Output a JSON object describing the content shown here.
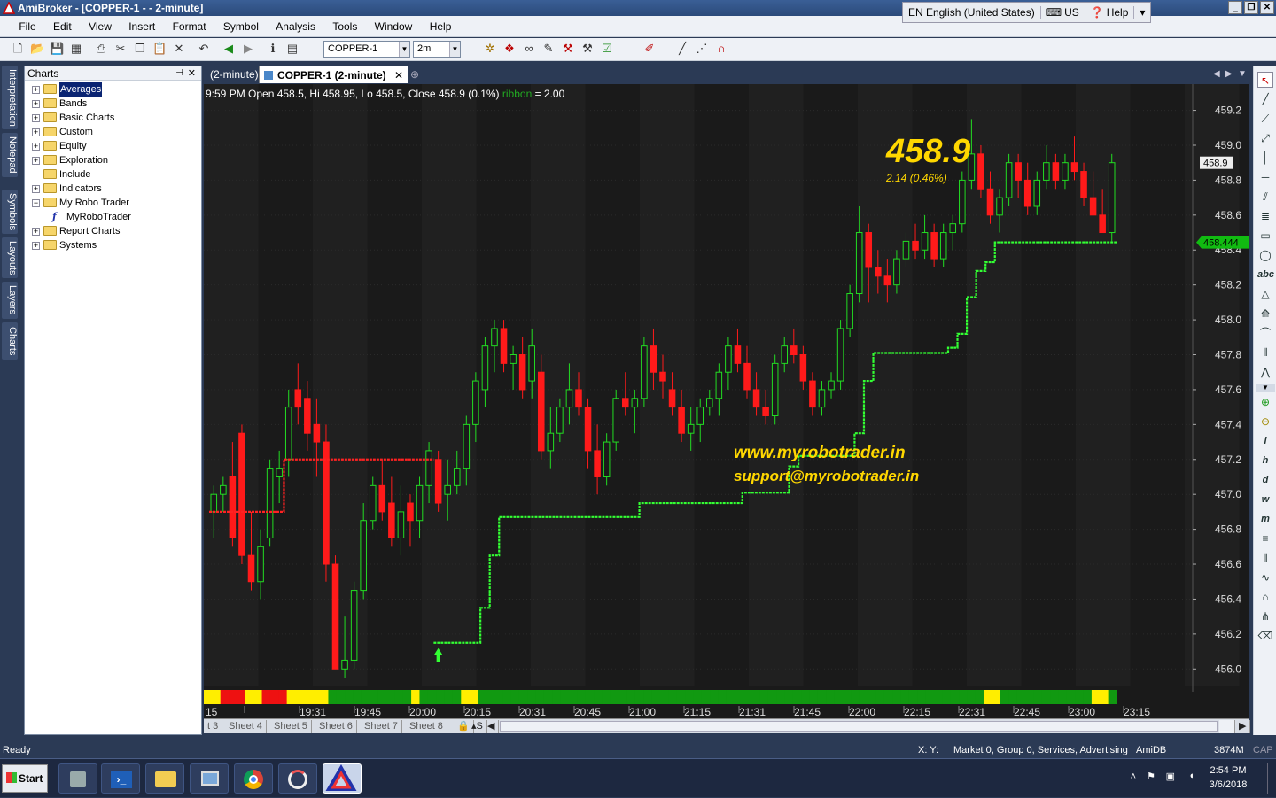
{
  "window": {
    "title": "AmiBroker - [COPPER-1 -  - 2-minute]",
    "buttons": [
      "_",
      "❐",
      "✕"
    ]
  },
  "menu": [
    "File",
    "Edit",
    "View",
    "Insert",
    "Format",
    "Symbol",
    "Analysis",
    "Tools",
    "Window",
    "Help"
  ],
  "langbar": {
    "language": "EN English (United States)",
    "keyboard": "US",
    "help": "Help"
  },
  "toolbar": {
    "symbol_combo": "COPPER-1",
    "interval_combo": "2m"
  },
  "left_tabs": [
    "Interpretation",
    "Notepad",
    "Symbols",
    "Layouts",
    "Layers",
    "Charts"
  ],
  "charts_panel": {
    "title": "Charts",
    "tree": [
      {
        "label": "Averages",
        "selected": true,
        "expandable": true,
        "type": "folder"
      },
      {
        "label": "Bands",
        "expandable": true,
        "type": "folder"
      },
      {
        "label": "Basic Charts",
        "expandable": true,
        "type": "folder"
      },
      {
        "label": "Custom",
        "expandable": true,
        "type": "folder"
      },
      {
        "label": "Equity",
        "expandable": true,
        "type": "folder"
      },
      {
        "label": "Exploration",
        "expandable": true,
        "type": "folder"
      },
      {
        "label": "Include",
        "expandable": false,
        "type": "folder"
      },
      {
        "label": "Indicators",
        "expandable": true,
        "type": "folder"
      },
      {
        "label": "My Robo Trader",
        "expandable": true,
        "expanded": true,
        "type": "folder"
      },
      {
        "label": "MyRoboTrader",
        "expandable": false,
        "type": "formula",
        "indent": 1
      },
      {
        "label": "Report Charts",
        "expandable": true,
        "type": "folder"
      },
      {
        "label": "Systems",
        "expandable": true,
        "type": "folder"
      }
    ]
  },
  "chart_tabs": [
    "(2-minute)",
    "COPPER-1 (2-minute)"
  ],
  "chart_header": {
    "ohlc": "9:59 PM Open 458.5, Hi 458.95, Lo 458.5, Close 458.9 (0.1%)",
    "indicator_name": "ribbon",
    "indicator_value": "= 2.00"
  },
  "price_overlay": {
    "last": "458.9",
    "change": "2.14  (0.46%)"
  },
  "watermark": {
    "site": "www.myrobotrader.in",
    "email": "support@myrobotrader.in"
  },
  "price_tags": {
    "close": "458.9",
    "stop": "458.444"
  },
  "colors": {
    "bull": "#22dd22",
    "bear": "#ff1a1a",
    "stop_up": "#33ff33",
    "stop_down": "#ff2222",
    "ribbon_green": "#119911",
    "ribbon_red": "#ee1111",
    "ribbon_yellow": "#ffee00",
    "overlay_yellow": "#ffd700"
  },
  "sheets": [
    "t 3",
    "Sheet 4",
    "Sheet 5",
    "Sheet 6",
    "Sheet 7",
    "Sheet 8"
  ],
  "right_tools": [
    "arrow-icon",
    "line-icon",
    "ray-icon",
    "extended-line-icon",
    "vertical-line-icon",
    "horizontal-line-icon",
    "channel-icon",
    "fibonacci-icon",
    "rectangle-icon",
    "ellipse-icon",
    "text-icon",
    "triangle-icon",
    "fan-icon",
    "arc-icon",
    "cycle-icon",
    "zigzag-icon",
    "arrow-up-icon",
    "arrow-down-icon",
    "info-icon",
    "hourly-icon",
    "daily-icon",
    "weekly-icon",
    "monthly-icon",
    "menu-icon",
    "bars-icon",
    "wave-icon",
    "gann-icon",
    "pitchfork-icon",
    "erase-icon"
  ],
  "right_tools_text": {
    "text_tool": "abc",
    "i": "i",
    "h": "h",
    "d": "d",
    "w": "w",
    "m": "m"
  },
  "status": {
    "left": "Ready",
    "coords": "X:   Y:",
    "market": "Market 0, Group 0, Services, Advertising",
    "db": "AmiDB",
    "memory": "3874M",
    "caps": "CAP"
  },
  "taskbar": {
    "start": "Start",
    "time": "2:54 PM",
    "date": "3/6/2018",
    "apps": [
      "server-manager-icon",
      "powershell-icon",
      "file-explorer-icon",
      "network-icon",
      "chrome-icon",
      "ami-broker-alt-icon",
      "amibroker-icon"
    ]
  },
  "chart_data": {
    "type": "candlestick",
    "y_axis_labels": [
      "459.2",
      "459.0",
      "458.8",
      "458.6",
      "458.4",
      "458.2",
      "458.0",
      "457.8",
      "457.6",
      "457.4",
      "457.2",
      "457.0",
      "456.8",
      "456.6",
      "456.4",
      "456.2",
      "456.0"
    ],
    "ylim": [
      455.9,
      459.35
    ],
    "x_tick_labels": [
      "15",
      "19:31",
      "19:45",
      "20:00",
      "20:15",
      "20:31",
      "20:45",
      "21:00",
      "21:15",
      "21:31",
      "21:45",
      "22:00",
      "22:15",
      "22:31",
      "22:45",
      "23:00",
      "23:15"
    ],
    "last_close": 458.9,
    "stop_value": 458.444,
    "candles_ohlc": [
      [
        456.9,
        457.05,
        456.75,
        457.0
      ],
      [
        457.0,
        457.1,
        456.9,
        457.05
      ],
      [
        457.1,
        457.3,
        456.7,
        456.75
      ],
      [
        457.35,
        457.4,
        456.6,
        456.65
      ],
      [
        456.65,
        456.9,
        456.45,
        456.5
      ],
      [
        456.5,
        456.8,
        456.4,
        456.7
      ],
      [
        456.75,
        457.2,
        456.7,
        457.15
      ],
      [
        457.1,
        457.25,
        456.95,
        457.15
      ],
      [
        457.2,
        457.6,
        457.1,
        457.5
      ],
      [
        457.6,
        457.75,
        457.4,
        457.5
      ],
      [
        457.55,
        457.65,
        457.25,
        457.35
      ],
      [
        457.4,
        457.55,
        457.1,
        457.3
      ],
      [
        457.3,
        457.4,
        456.5,
        456.6
      ],
      [
        456.6,
        456.65,
        456.0,
        456.0
      ],
      [
        456.0,
        456.3,
        455.95,
        456.05
      ],
      [
        456.05,
        456.5,
        456.0,
        456.45
      ],
      [
        456.45,
        456.95,
        456.4,
        456.85
      ],
      [
        456.85,
        457.1,
        456.8,
        457.05
      ],
      [
        457.05,
        457.2,
        456.85,
        456.9
      ],
      [
        456.95,
        457.1,
        456.7,
        456.75
      ],
      [
        456.75,
        457.05,
        456.65,
        456.9
      ],
      [
        456.95,
        457.0,
        456.7,
        456.85
      ],
      [
        456.85,
        457.1,
        456.75,
        457.05
      ],
      [
        457.05,
        457.3,
        456.95,
        457.25
      ],
      [
        457.2,
        457.25,
        456.9,
        456.95
      ],
      [
        457.0,
        457.2,
        456.85,
        457.05
      ],
      [
        457.05,
        457.25,
        457.0,
        457.15
      ],
      [
        457.15,
        457.45,
        457.05,
        457.4
      ],
      [
        457.4,
        457.7,
        457.3,
        457.65
      ],
      [
        457.6,
        457.9,
        457.5,
        457.85
      ],
      [
        457.85,
        458.0,
        457.7,
        457.95
      ],
      [
        457.95,
        458.0,
        457.7,
        457.75
      ],
      [
        457.75,
        457.85,
        457.6,
        457.8
      ],
      [
        457.8,
        457.9,
        457.55,
        457.6
      ],
      [
        457.65,
        457.95,
        457.55,
        457.85
      ],
      [
        457.7,
        457.8,
        457.2,
        457.25
      ],
      [
        457.25,
        457.5,
        457.15,
        457.35
      ],
      [
        457.35,
        457.55,
        457.3,
        457.5
      ],
      [
        457.5,
        457.75,
        457.4,
        457.6
      ],
      [
        457.6,
        457.7,
        457.45,
        457.5
      ],
      [
        457.5,
        457.55,
        457.15,
        457.25
      ],
      [
        457.25,
        457.4,
        457.0,
        457.1
      ],
      [
        457.1,
        457.35,
        457.05,
        457.3
      ],
      [
        457.3,
        457.6,
        457.25,
        457.55
      ],
      [
        457.55,
        457.7,
        457.45,
        457.5
      ],
      [
        457.5,
        457.6,
        457.35,
        457.55
      ],
      [
        457.55,
        457.9,
        457.5,
        457.85
      ],
      [
        457.85,
        457.95,
        457.6,
        457.7
      ],
      [
        457.7,
        457.8,
        457.55,
        457.65
      ],
      [
        457.6,
        457.7,
        457.45,
        457.5
      ],
      [
        457.5,
        457.6,
        457.3,
        457.35
      ],
      [
        457.35,
        457.5,
        457.25,
        457.4
      ],
      [
        457.4,
        457.55,
        457.3,
        457.5
      ],
      [
        457.5,
        457.6,
        457.45,
        457.55
      ],
      [
        457.55,
        457.75,
        457.45,
        457.7
      ],
      [
        457.7,
        457.9,
        457.6,
        457.85
      ],
      [
        457.85,
        457.95,
        457.7,
        457.75
      ],
      [
        457.75,
        457.85,
        457.55,
        457.6
      ],
      [
        457.6,
        457.7,
        457.45,
        457.5
      ],
      [
        457.5,
        457.6,
        457.4,
        457.45
      ],
      [
        457.45,
        457.8,
        457.4,
        457.75
      ],
      [
        457.75,
        457.9,
        457.7,
        457.85
      ],
      [
        457.85,
        457.95,
        457.75,
        457.8
      ],
      [
        457.8,
        457.85,
        457.6,
        457.65
      ],
      [
        457.65,
        457.7,
        457.45,
        457.5
      ],
      [
        457.5,
        457.65,
        457.45,
        457.6
      ],
      [
        457.6,
        457.7,
        457.55,
        457.65
      ],
      [
        457.65,
        458.0,
        457.6,
        457.95
      ],
      [
        457.95,
        458.2,
        457.9,
        458.15
      ],
      [
        458.15,
        458.65,
        458.1,
        458.5
      ],
      [
        458.5,
        458.55,
        458.1,
        458.3
      ],
      [
        458.3,
        458.4,
        458.15,
        458.25
      ],
      [
        458.25,
        458.35,
        458.1,
        458.2
      ],
      [
        458.2,
        458.4,
        458.15,
        458.35
      ],
      [
        458.35,
        458.5,
        458.3,
        458.45
      ],
      [
        458.45,
        458.55,
        458.35,
        458.4
      ],
      [
        458.4,
        458.6,
        458.35,
        458.5
      ],
      [
        458.5,
        458.55,
        458.3,
        458.35
      ],
      [
        458.35,
        458.55,
        458.3,
        458.5
      ],
      [
        458.5,
        458.6,
        458.4,
        458.55
      ],
      [
        458.55,
        458.85,
        458.5,
        458.8
      ],
      [
        458.8,
        459.15,
        458.75,
        458.95
      ],
      [
        458.95,
        459.0,
        458.7,
        458.75
      ],
      [
        458.75,
        458.85,
        458.55,
        458.6
      ],
      [
        458.6,
        458.75,
        458.5,
        458.7
      ],
      [
        458.7,
        458.95,
        458.65,
        458.9
      ],
      [
        458.9,
        458.95,
        458.7,
        458.8
      ],
      [
        458.8,
        458.9,
        458.6,
        458.65
      ],
      [
        458.65,
        458.85,
        458.6,
        458.8
      ],
      [
        458.8,
        459.0,
        458.75,
        458.9
      ],
      [
        458.9,
        458.95,
        458.75,
        458.8
      ],
      [
        458.8,
        458.95,
        458.75,
        458.9
      ],
      [
        458.9,
        459.05,
        458.8,
        458.85
      ],
      [
        458.85,
        458.9,
        458.65,
        458.7
      ],
      [
        458.7,
        458.85,
        458.6,
        458.6
      ],
      [
        458.6,
        458.75,
        458.5,
        458.5
      ],
      [
        458.5,
        458.95,
        458.45,
        458.9
      ]
    ],
    "stop_line": [
      456.9,
      456.9,
      456.9,
      456.9,
      456.9,
      456.9,
      456.9,
      456.9,
      457.2,
      457.2,
      457.2,
      457.2,
      457.2,
      457.2,
      457.2,
      457.2,
      457.2,
      457.2,
      457.2,
      457.2,
      457.2,
      457.2,
      457.2,
      457.2,
      456.15,
      456.15,
      456.15,
      456.15,
      456.15,
      456.35,
      456.65,
      456.87,
      456.87,
      456.87,
      456.87,
      456.87,
      456.87,
      456.87,
      456.87,
      456.87,
      456.87,
      456.87,
      456.87,
      456.87,
      456.87,
      456.87,
      456.95,
      456.95,
      456.95,
      456.95,
      456.95,
      456.95,
      456.95,
      456.95,
      456.95,
      456.95,
      456.95,
      457.01,
      457.01,
      457.01,
      457.01,
      457.01,
      457.16,
      457.22,
      457.22,
      457.22,
      457.22,
      457.22,
      457.22,
      457.35,
      457.65,
      457.81,
      457.81,
      457.81,
      457.81,
      457.81,
      457.81,
      457.81,
      457.81,
      457.84,
      457.92,
      458.13,
      458.28,
      458.33,
      458.444,
      458.444,
      458.444,
      458.444,
      458.444,
      458.444,
      458.444,
      458.444,
      458.444,
      458.444,
      458.444,
      458.444,
      458.444,
      458.444
    ],
    "stop_side": "down_until_24_then_up",
    "ribbon": [
      "Y",
      "Y",
      "R",
      "R",
      "R",
      "Y",
      "Y",
      "R",
      "R",
      "R",
      "Y",
      "Y",
      "Y",
      "Y",
      "Y",
      "G",
      "G",
      "G",
      "G",
      "G",
      "G",
      "G",
      "G",
      "G",
      "G",
      "Y",
      "G",
      "G",
      "G",
      "G",
      "G",
      "Y",
      "Y",
      "G",
      "G",
      "G",
      "G",
      "G",
      "G",
      "G",
      "G",
      "G",
      "G",
      "G",
      "G",
      "G",
      "G",
      "G",
      "G",
      "G",
      "G",
      "G",
      "G",
      "G",
      "G",
      "G",
      "G",
      "G",
      "G",
      "G",
      "G",
      "G",
      "G",
      "G",
      "G",
      "G",
      "G",
      "G",
      "G",
      "G",
      "G",
      "G",
      "G",
      "G",
      "G",
      "G",
      "G",
      "G",
      "G",
      "G",
      "G",
      "G",
      "G",
      "G",
      "G",
      "G",
      "G",
      "G",
      "G",
      "G",
      "G",
      "G",
      "G",
      "G",
      "Y",
      "Y",
      "G",
      "G",
      "G",
      "G",
      "G",
      "G",
      "G",
      "G",
      "G",
      "G",
      "G",
      "Y",
      "Y",
      "G"
    ]
  }
}
